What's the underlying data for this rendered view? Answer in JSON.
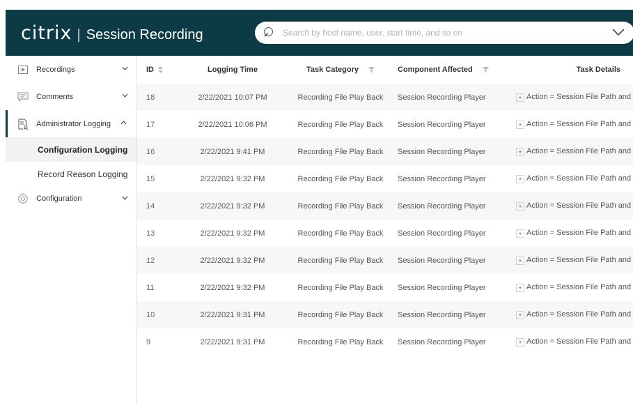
{
  "header": {
    "logo": "citrix",
    "separator": "|",
    "product": "Session Recording",
    "bg_color": "#0d3b45"
  },
  "search": {
    "placeholder": "Search by host name, user, start time, and so on"
  },
  "sidebar": {
    "items": [
      {
        "label": "Recordings",
        "icon": "play-icon",
        "expanded": false
      },
      {
        "label": "Comments",
        "icon": "comment-icon",
        "expanded": false
      },
      {
        "label": "Administrator Logging",
        "icon": "admin-log-icon",
        "expanded": true,
        "children": [
          {
            "label": "Configuration Logging",
            "selected": true
          },
          {
            "label": "Record Reason Logging",
            "selected": false
          }
        ]
      },
      {
        "label": "Configuration",
        "icon": "gear-icon",
        "expanded": false
      }
    ]
  },
  "table": {
    "columns": [
      "ID",
      "Logging Time",
      "Task Category",
      "Component Affected",
      "Task Details"
    ],
    "rows": [
      {
        "id": "18",
        "time": "2/22/2021 10:07 PM",
        "category": "Recording File Play Back",
        "component": "Session Recording Player",
        "details": "Action = Session File Path and"
      },
      {
        "id": "17",
        "time": "2/22/2021 10:06 PM",
        "category": "Recording File Play Back",
        "component": "Session Recording Player",
        "details": "Action = Session File Path and"
      },
      {
        "id": "16",
        "time": "2/22/2021 9:41 PM",
        "category": "Recording File Play Back",
        "component": "Session Recording Player",
        "details": "Action = Session File Path and"
      },
      {
        "id": "15",
        "time": "2/22/2021 9:32 PM",
        "category": "Recording File Play Back",
        "component": "Session Recording Player",
        "details": "Action = Session File Path and"
      },
      {
        "id": "14",
        "time": "2/22/2021 9:32 PM",
        "category": "Recording File Play Back",
        "component": "Session Recording Player",
        "details": "Action = Session File Path and"
      },
      {
        "id": "13",
        "time": "2/22/2021 9:32 PM",
        "category": "Recording File Play Back",
        "component": "Session Recording Player",
        "details": "Action = Session File Path and"
      },
      {
        "id": "12",
        "time": "2/22/2021 9:32 PM",
        "category": "Recording File Play Back",
        "component": "Session Recording Player",
        "details": "Action = Session File Path and"
      },
      {
        "id": "11",
        "time": "2/22/2021 9:32 PM",
        "category": "Recording File Play Back",
        "component": "Session Recording Player",
        "details": "Action = Session File Path and"
      },
      {
        "id": "10",
        "time": "2/22/2021 9:31 PM",
        "category": "Recording File Play Back",
        "component": "Session Recording Player",
        "details": "Action = Session File Path and"
      },
      {
        "id": "9",
        "time": "2/22/2021 9:31 PM",
        "category": "Recording File Play Back",
        "component": "Session Recording Player",
        "details": "Action = Session File Path and"
      }
    ],
    "expand_symbol": "+"
  }
}
